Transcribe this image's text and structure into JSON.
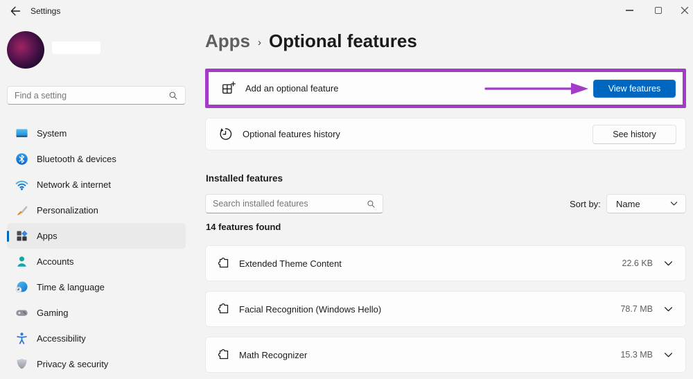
{
  "window": {
    "title": "Settings"
  },
  "sidebar": {
    "search": {
      "placeholder": "Find a setting"
    },
    "items": [
      {
        "label": "System",
        "icon": "system-icon",
        "selected": false
      },
      {
        "label": "Bluetooth & devices",
        "icon": "bluetooth-icon",
        "selected": false
      },
      {
        "label": "Network & internet",
        "icon": "network-icon",
        "selected": false
      },
      {
        "label": "Personalization",
        "icon": "personalization-icon",
        "selected": false
      },
      {
        "label": "Apps",
        "icon": "apps-icon",
        "selected": true
      },
      {
        "label": "Accounts",
        "icon": "accounts-icon",
        "selected": false
      },
      {
        "label": "Time & language",
        "icon": "time-language-icon",
        "selected": false
      },
      {
        "label": "Gaming",
        "icon": "gaming-icon",
        "selected": false
      },
      {
        "label": "Accessibility",
        "icon": "accessibility-icon",
        "selected": false
      },
      {
        "label": "Privacy & security",
        "icon": "privacy-security-icon",
        "selected": false
      }
    ]
  },
  "breadcrumb": {
    "parent": "Apps",
    "separator": "›",
    "current": "Optional features"
  },
  "cards": {
    "add_feature": {
      "label": "Add an optional feature",
      "icon": "add-feature-icon",
      "button": "View features"
    },
    "history": {
      "label": "Optional features history",
      "icon": "history-icon",
      "button": "See history"
    }
  },
  "installed": {
    "heading": "Installed features",
    "search": {
      "placeholder": "Search installed features"
    },
    "sort": {
      "label": "Sort by:",
      "value": "Name"
    },
    "count": "14 features found",
    "features": [
      {
        "name": "Extended Theme Content",
        "size": "22.6 KB",
        "icon": "puzzle-icon"
      },
      {
        "name": "Facial Recognition (Windows Hello)",
        "size": "78.7 MB",
        "icon": "puzzle-icon"
      },
      {
        "name": "Math Recognizer",
        "size": "15.3 MB",
        "icon": "puzzle-icon"
      }
    ]
  },
  "annotation": {
    "highlight_color": "#a43bc6"
  },
  "colors": {
    "accent": "#0067c0",
    "background": "#f3f3f3",
    "card": "#fdfdfd"
  }
}
